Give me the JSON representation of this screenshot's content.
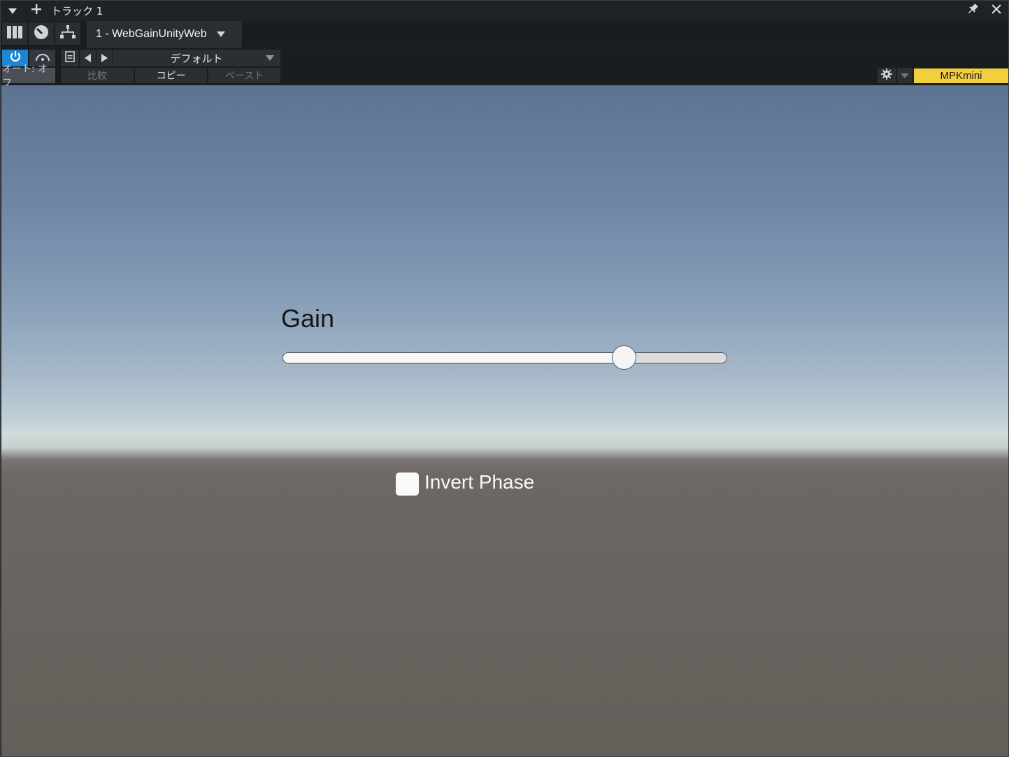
{
  "titlebar": {
    "track_title": "トラック 1",
    "icons": [
      "chevron-down-icon",
      "plus-icon",
      "pin-icon",
      "close-icon"
    ]
  },
  "plugin_bar": {
    "plugin_name": "1 - WebGainUnityWeb",
    "icons": [
      "mixer-icon",
      "routing-icon",
      "hierarchy-icon"
    ]
  },
  "preset_bar": {
    "preset_name": "デフォルト",
    "power_active": true,
    "icons": [
      "power-icon",
      "bypass-icon",
      "preset-file-icon",
      "prev-arrow-icon",
      "next-arrow-icon"
    ]
  },
  "action_bar": {
    "auto_label": "オート: オフ",
    "compare_label": "比較",
    "copy_label": "コピー",
    "paste_label": "ペースト",
    "device_label": "MPKmini",
    "device_color": "#f2cf3c"
  },
  "viewport": {
    "gain_label": "Gain",
    "gain_value": 0.785,
    "invert_phase_label": "Invert Phase",
    "invert_phase_checked": false
  }
}
